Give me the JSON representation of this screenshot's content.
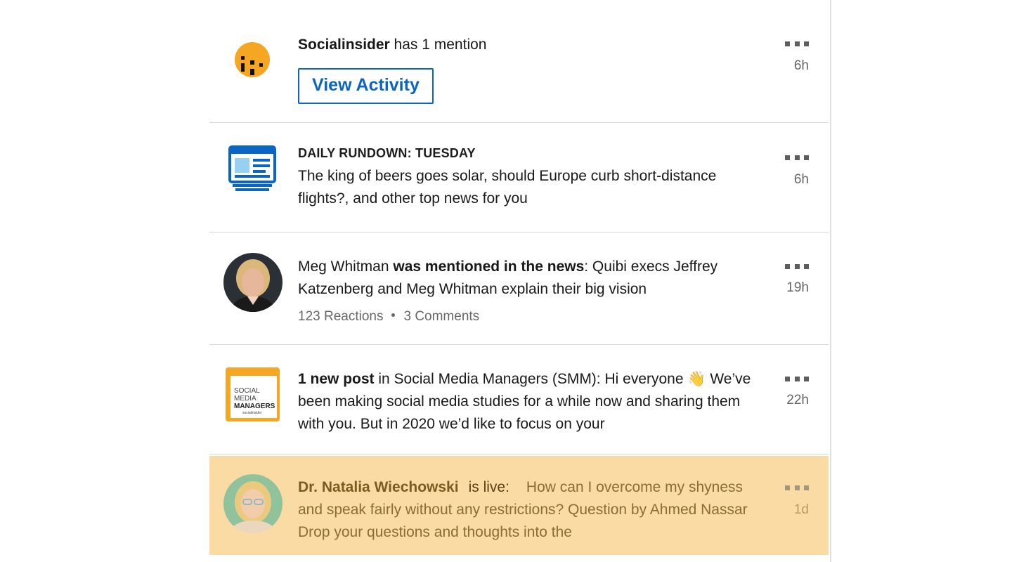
{
  "notifications": [
    {
      "name_bold": "Socialinsider",
      "text": " has 1 mention",
      "button_label": "View Activity",
      "time": "6h"
    },
    {
      "kicker": "DAILY RUNDOWN: TUESDAY",
      "text": "The king of beers goes solar, should Europe curb short-distance flights?, and other top news for you",
      "time": "6h"
    },
    {
      "name": "Meg Whitman ",
      "action_bold": "was mentioned in the news",
      "text": ": Quibi execs Jeffrey Katzenberg and Meg Whitman explain their big vision",
      "reactions": "123 Reactions",
      "comments": "3 Comments",
      "time": "19h"
    },
    {
      "count_bold": "1 new post",
      "text": " in Social Media Managers (SMM): Hi everyone 👋 We’ve been making social media studies for a while now and sharing them with you. But in 2020 we’d like to focus on your",
      "logo_line1": "SOCIAL",
      "logo_line2": "MEDIA",
      "logo_line3": "MANAGERS",
      "logo_small": "socialinsider",
      "time": "22h"
    },
    {
      "name": "Dr. Natalia Wiechowski",
      "live_label": "is live:",
      "text": "How can I overcome my shyness and speak fairly without any restrictions? Question by Ahmed Nassar Drop your questions and thoughts into the",
      "time": "1d"
    }
  ],
  "colors": {
    "brand_blue": "#0a66c2",
    "highlight_bg": "#fbdba4",
    "socialinsider_yellow": "#f5a623"
  },
  "icons": {
    "menu": "more-horizontal-icon",
    "news": "newspaper-icon"
  }
}
